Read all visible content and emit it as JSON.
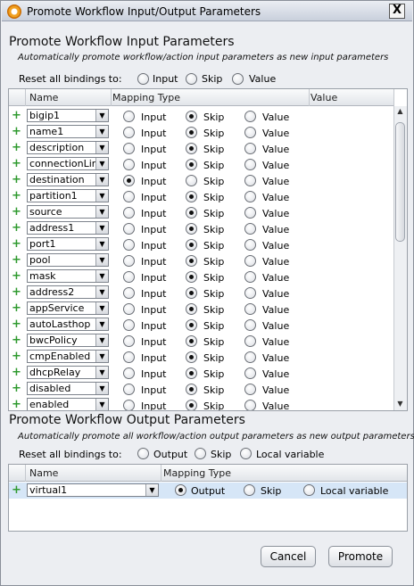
{
  "window": {
    "title": "Promote Workflow Input/Output Parameters",
    "close_glyph": "X",
    "icon": "app-icon"
  },
  "input_section": {
    "title": "Promote Workflow Input Parameters",
    "subtitle": "Automatically promote workflow/action input parameters as new input parameters",
    "reset_label": "Reset all bindings to:",
    "reset_options": [
      "Input",
      "Skip",
      "Value"
    ],
    "columns": [
      "Name",
      "Mapping Type",
      "Value"
    ],
    "option_labels": [
      "Input",
      "Skip",
      "Value"
    ],
    "rows": [
      {
        "name": "bigip1",
        "mapping": "Skip"
      },
      {
        "name": "name1",
        "mapping": "Skip"
      },
      {
        "name": "description",
        "mapping": "Skip"
      },
      {
        "name": "connectionLim",
        "mapping": "Skip"
      },
      {
        "name": "destination",
        "mapping": "Input"
      },
      {
        "name": "partition1",
        "mapping": "Skip"
      },
      {
        "name": "source",
        "mapping": "Skip"
      },
      {
        "name": "address1",
        "mapping": "Skip"
      },
      {
        "name": "port1",
        "mapping": "Skip"
      },
      {
        "name": "pool",
        "mapping": "Skip"
      },
      {
        "name": "mask",
        "mapping": "Skip"
      },
      {
        "name": "address2",
        "mapping": "Skip"
      },
      {
        "name": "appService",
        "mapping": "Skip"
      },
      {
        "name": "autoLasthop",
        "mapping": "Skip"
      },
      {
        "name": "bwcPolicy",
        "mapping": "Skip"
      },
      {
        "name": "cmpEnabled",
        "mapping": "Skip"
      },
      {
        "name": "dhcpRelay",
        "mapping": "Skip"
      },
      {
        "name": "disabled",
        "mapping": "Skip"
      },
      {
        "name": "enabled",
        "mapping": "Skip"
      }
    ]
  },
  "output_section": {
    "title": "Promote Workflow Output Parameters",
    "subtitle": "Automatically promote all workflow/action output parameters as new output parameters",
    "reset_label": "Reset all bindings to:",
    "reset_options": [
      "Output",
      "Skip",
      "Local variable"
    ],
    "columns": [
      "Name",
      "Mapping Type"
    ],
    "option_labels": [
      "Output",
      "Skip",
      "Local variable"
    ],
    "rows": [
      {
        "name": "virtual1",
        "mapping": "Output"
      }
    ]
  },
  "buttons": {
    "cancel": "Cancel",
    "promote": "Promote"
  },
  "colors": {
    "add_icon": "#2f9a2f",
    "selected_row": "#d6e6f7",
    "dialog_bg": "#eceef2"
  }
}
